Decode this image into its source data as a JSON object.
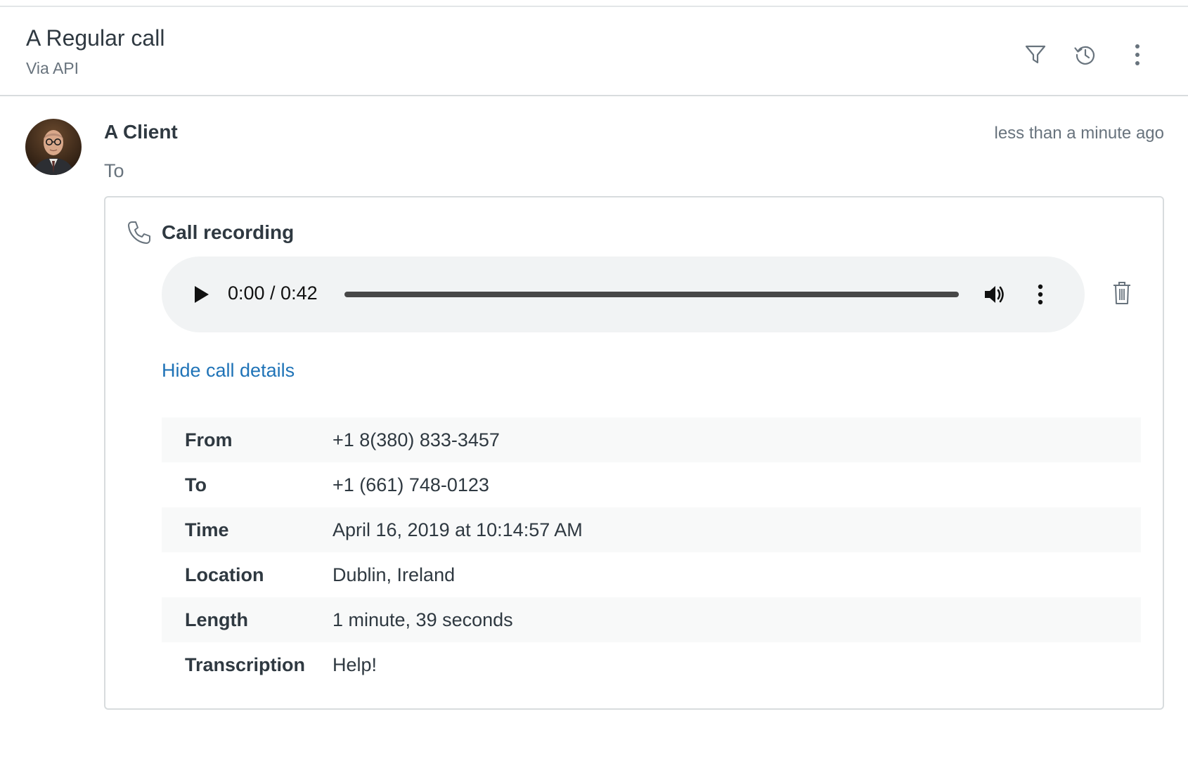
{
  "header": {
    "title": "A Regular call",
    "subtitle": "Via API",
    "icons": [
      "filter-icon",
      "history-icon",
      "more-vertical-icon"
    ]
  },
  "event": {
    "author": "A Client",
    "timestamp": "less than a minute ago",
    "to_label": "To"
  },
  "card": {
    "title": "Call recording",
    "icon": "phone-icon",
    "player": {
      "time_display": "0:00 / 0:42",
      "progress": 0
    },
    "details_link": "Hide call details",
    "details": [
      {
        "key": "From",
        "value": "+1 8(380) 833-3457"
      },
      {
        "key": "To",
        "value": "+1 (661) 748-0123"
      },
      {
        "key": "Time",
        "value": "April 16, 2019 at 10:14:57 AM"
      },
      {
        "key": "Location",
        "value": "Dublin, Ireland"
      },
      {
        "key": "Length",
        "value": "1 minute, 39 seconds"
      },
      {
        "key": "Transcription",
        "value": "Help!"
      }
    ]
  },
  "colors": {
    "link": "#1f73b7",
    "text": "#2f3941",
    "muted": "#68737d",
    "border": "#d8dcde",
    "row_shade": "#f8f9f9",
    "player_bg": "#f1f3f4"
  }
}
